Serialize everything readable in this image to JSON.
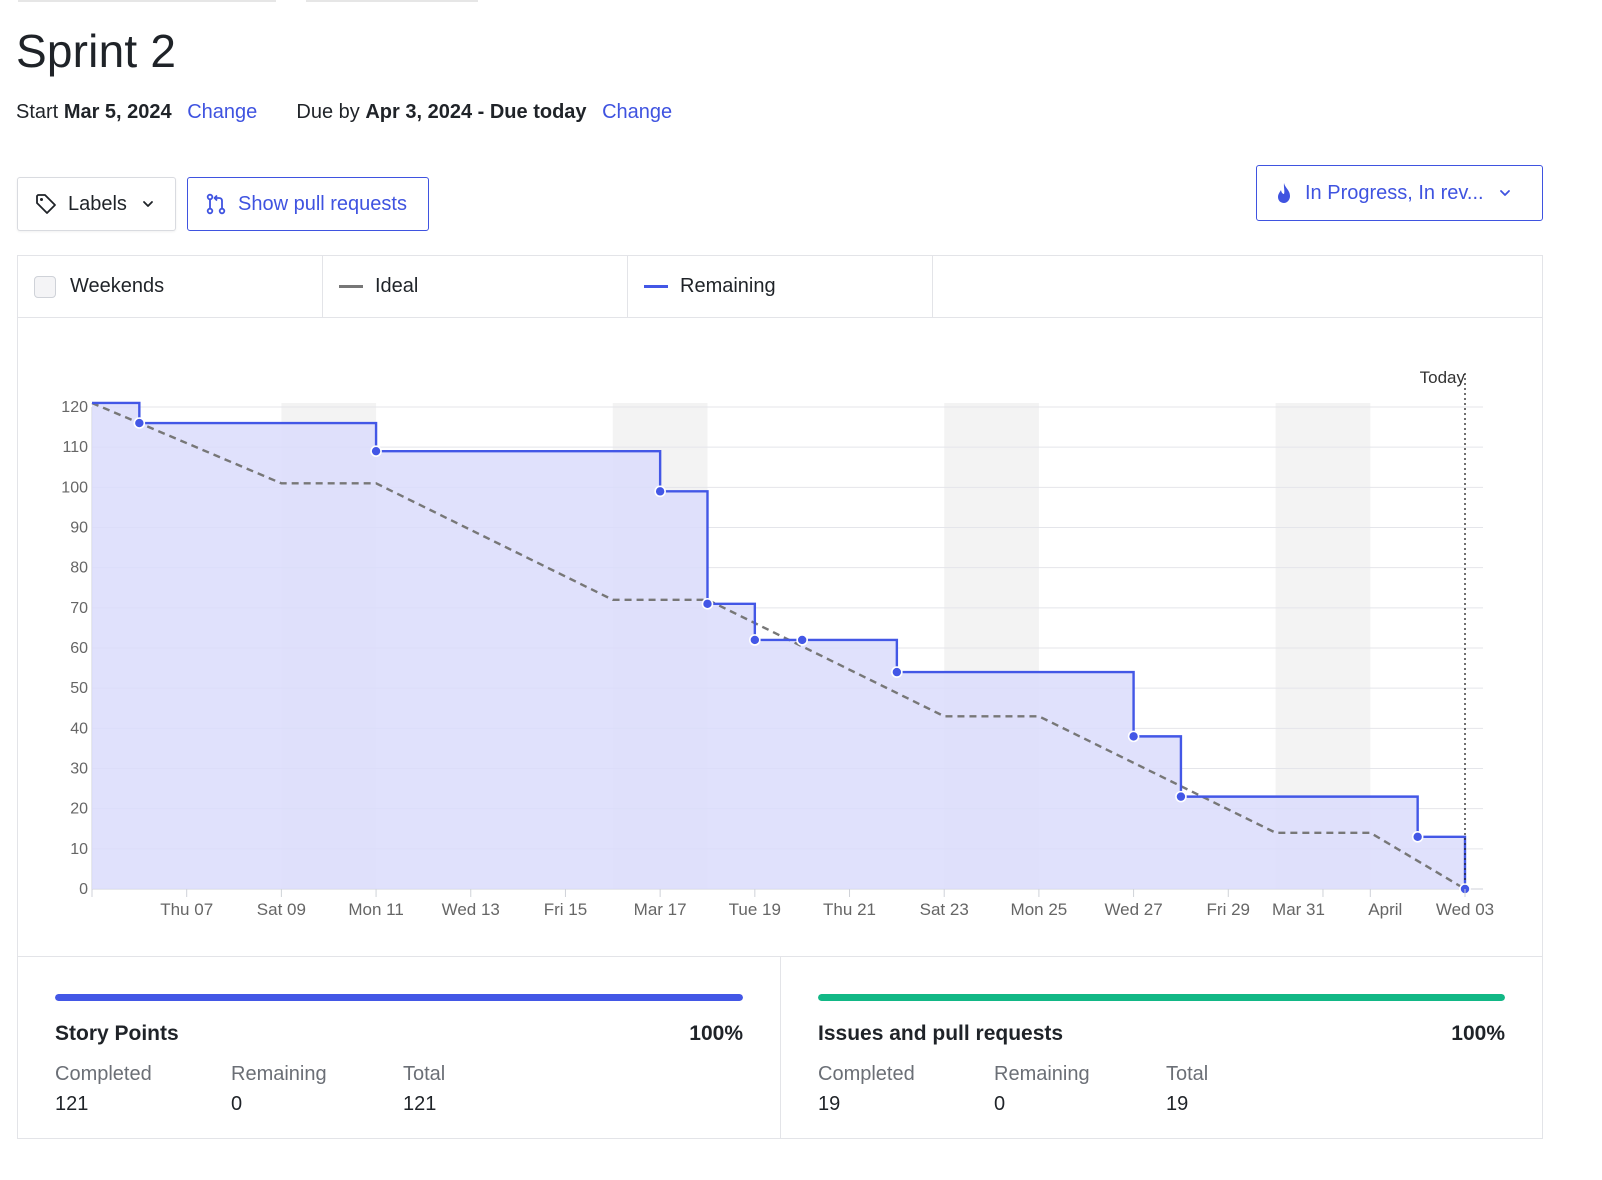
{
  "sprint": {
    "title": "Sprint 2",
    "start_label": "Start",
    "start_date": "Mar 5, 2024",
    "start_change": "Change",
    "due_label": "Due by",
    "due_date": "Apr 3, 2024 - Due today",
    "due_change": "Change"
  },
  "toolbar": {
    "labels_button": "Labels",
    "pull_requests_button": "Show pull requests",
    "status_filter": "In Progress, In rev..."
  },
  "legend": {
    "weekends": "Weekends",
    "ideal": "Ideal",
    "remaining": "Remaining"
  },
  "colors": {
    "accent": "#3f53e0",
    "remaining_line": "#4357e6",
    "remaining_fill": "#dadcfb",
    "ideal_line": "#777777",
    "weekend_band": "#f3f3f3",
    "issues_bar": "#12b886"
  },
  "chart_data": {
    "type": "line",
    "title": "",
    "xlabel": "",
    "ylabel": "",
    "x_range": [
      "2024-03-05",
      "2024-04-03"
    ],
    "ylim": [
      0,
      120
    ],
    "yticks": [
      0,
      10,
      20,
      30,
      40,
      50,
      60,
      70,
      80,
      90,
      100,
      110,
      120
    ],
    "xtick_labels": [
      {
        "date": "2024-03-07",
        "label": "Thu 07"
      },
      {
        "date": "2024-03-09",
        "label": "Sat 09"
      },
      {
        "date": "2024-03-11",
        "label": "Mon 11"
      },
      {
        "date": "2024-03-13",
        "label": "Wed 13"
      },
      {
        "date": "2024-03-15",
        "label": "Fri 15"
      },
      {
        "date": "2024-03-17",
        "label": "Mar 17"
      },
      {
        "date": "2024-03-19",
        "label": "Tue 19"
      },
      {
        "date": "2024-03-21",
        "label": "Thu 21"
      },
      {
        "date": "2024-03-23",
        "label": "Sat 23"
      },
      {
        "date": "2024-03-25",
        "label": "Mon 25"
      },
      {
        "date": "2024-03-27",
        "label": "Wed 27"
      },
      {
        "date": "2024-03-29",
        "label": "Fri 29"
      },
      {
        "date": "2024-03-31",
        "label": "Mar 31"
      },
      {
        "date": "2024-04-01",
        "label": "April"
      },
      {
        "date": "2024-04-03",
        "label": "Wed 03"
      }
    ],
    "grid": true,
    "weekends": [
      [
        "2024-03-09",
        "2024-03-11"
      ],
      [
        "2024-03-16",
        "2024-03-18"
      ],
      [
        "2024-03-23",
        "2024-03-25"
      ],
      [
        "2024-03-30",
        "2024-04-01"
      ]
    ],
    "today": {
      "date": "2024-04-03",
      "label": "Today"
    },
    "series": [
      {
        "name": "Ideal",
        "style": "dashed",
        "points": [
          [
            "2024-03-05",
            121
          ],
          [
            "2024-03-09",
            101
          ],
          [
            "2024-03-11",
            101
          ],
          [
            "2024-03-16",
            72
          ],
          [
            "2024-03-18",
            72
          ],
          [
            "2024-03-23",
            43
          ],
          [
            "2024-03-25",
            43
          ],
          [
            "2024-03-30",
            14
          ],
          [
            "2024-04-01",
            14
          ],
          [
            "2024-04-03",
            0
          ]
        ]
      },
      {
        "name": "Remaining",
        "style": "step",
        "points": [
          [
            "2024-03-05",
            121
          ],
          [
            "2024-03-06",
            116
          ],
          [
            "2024-03-11",
            109
          ],
          [
            "2024-03-17",
            99
          ],
          [
            "2024-03-18",
            71
          ],
          [
            "2024-03-19",
            62
          ],
          [
            "2024-03-20",
            62
          ],
          [
            "2024-03-22",
            54
          ],
          [
            "2024-03-27",
            38
          ],
          [
            "2024-03-28",
            23
          ],
          [
            "2024-04-02",
            13
          ],
          [
            "2024-04-03",
            0
          ]
        ]
      }
    ]
  },
  "stats": {
    "story_points": {
      "title": "Story Points",
      "percent": "100%",
      "percent_value": 100,
      "completed_label": "Completed",
      "completed": "121",
      "remaining_label": "Remaining",
      "remaining": "0",
      "total_label": "Total",
      "total": "121"
    },
    "issues": {
      "title": "Issues and pull requests",
      "percent": "100%",
      "percent_value": 100,
      "completed_label": "Completed",
      "completed": "19",
      "remaining_label": "Remaining",
      "remaining": "0",
      "total_label": "Total",
      "total": "19"
    }
  }
}
